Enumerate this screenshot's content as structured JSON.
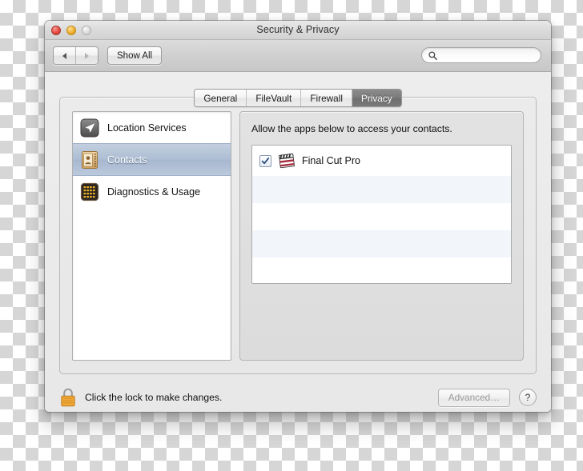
{
  "window": {
    "title": "Security & Privacy",
    "traffic_lights": [
      "close-button",
      "minimize-button",
      "zoom-button"
    ]
  },
  "toolbar": {
    "back_label": "",
    "forward_label": "",
    "show_all_label": "Show All",
    "search": {
      "value": "",
      "placeholder": ""
    }
  },
  "tabs": [
    {
      "label": "General",
      "active": false
    },
    {
      "label": "FileVault",
      "active": false
    },
    {
      "label": "Firewall",
      "active": false
    },
    {
      "label": "Privacy",
      "active": true
    }
  ],
  "sidebar": {
    "items": [
      {
        "label": "Location Services",
        "icon": "location-arrow-icon",
        "selected": false
      },
      {
        "label": "Contacts",
        "icon": "address-book-icon",
        "selected": true
      },
      {
        "label": "Diagnostics & Usage",
        "icon": "diagnostics-console-icon",
        "selected": false
      }
    ]
  },
  "main": {
    "description": "Allow the apps below to access your contacts.",
    "apps": [
      {
        "name": "Final Cut Pro",
        "checked": true,
        "icon": "clapperboard-icon"
      }
    ]
  },
  "footer": {
    "lock_icon": "closed-padlock-icon",
    "lock_text": "Click the lock to make changes.",
    "advanced_label": "Advanced…",
    "advanced_enabled": false,
    "help_label": "?"
  },
  "colors": {
    "tab_active_bg": "#7c7c7c",
    "sidebar_selected_bg": "#adbdd3",
    "list_alt_row": "#f2f5fa",
    "lock_gold": "#f0a83a",
    "traffic_red": "#e8534a",
    "traffic_yellow": "#f2b63c",
    "traffic_gray": "#dcdcdc"
  }
}
